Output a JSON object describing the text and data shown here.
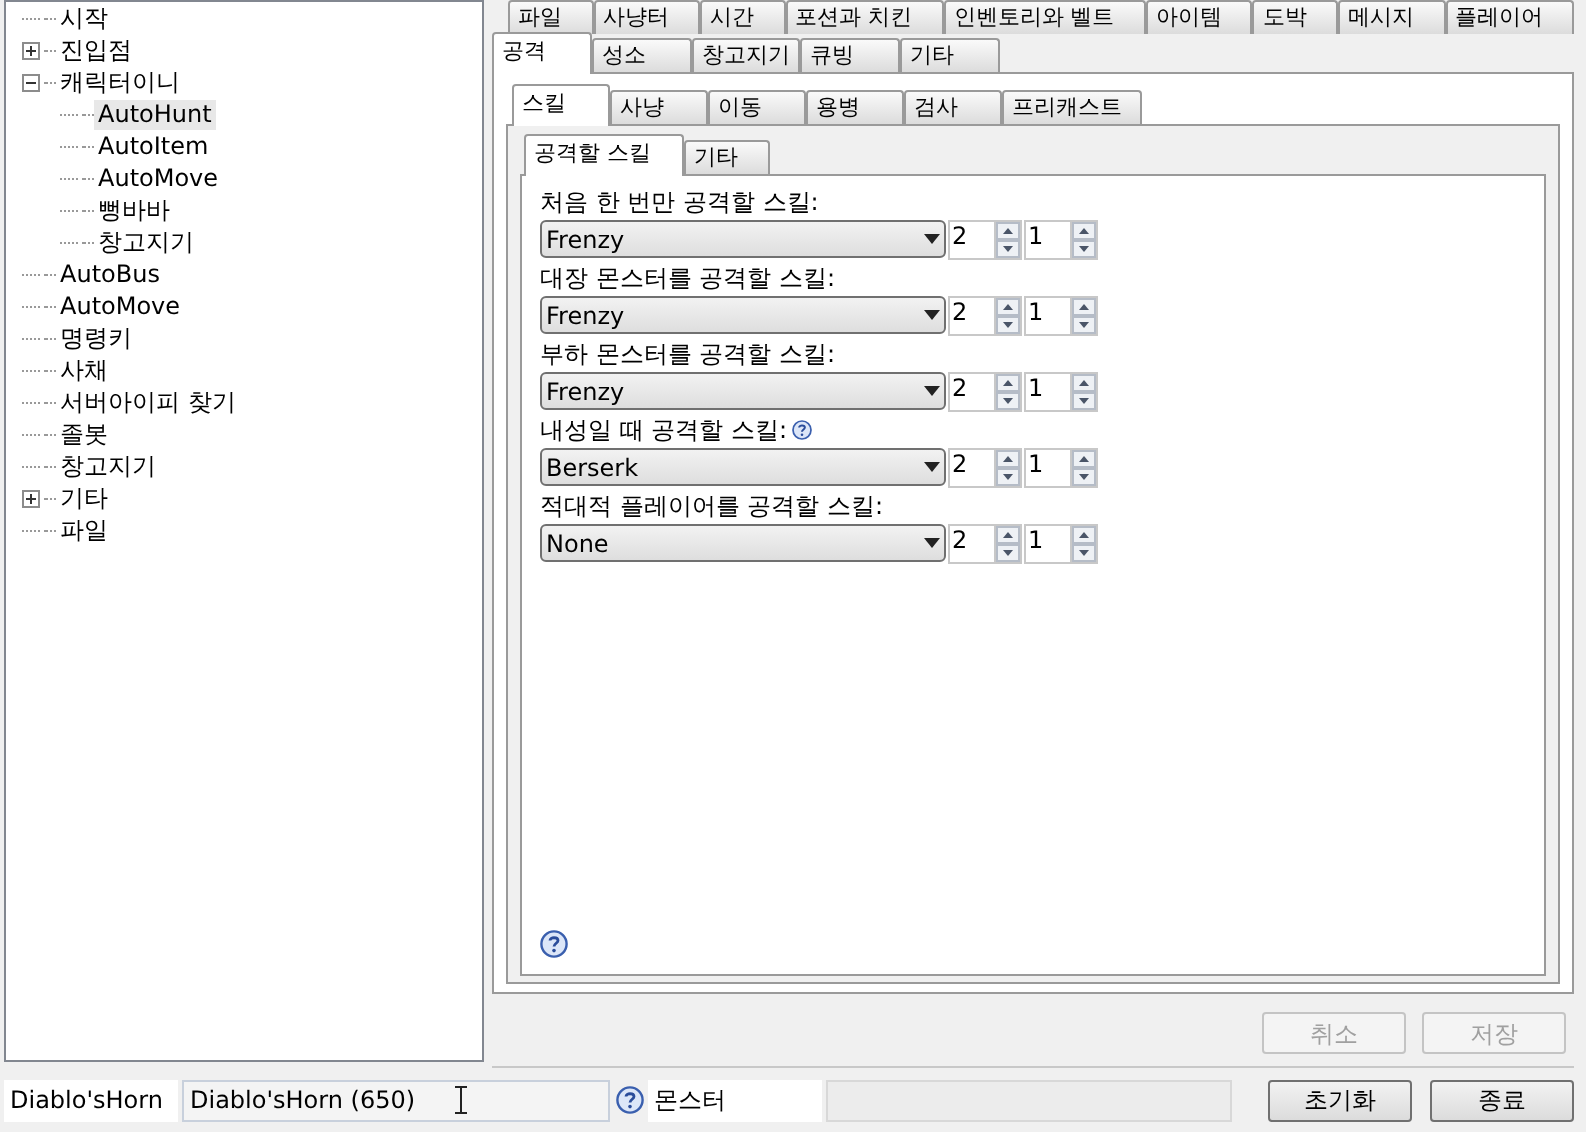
{
  "tree": [
    {
      "label": "시작",
      "selected": false
    },
    {
      "label": "진입점",
      "selected": false,
      "expanded": false
    },
    {
      "label": "캐릭터이니",
      "selected": false,
      "expanded": true,
      "children": [
        {
          "label": "AutoHunt",
          "selected": true
        },
        {
          "label": "AutoItem",
          "selected": false
        },
        {
          "label": "AutoMove",
          "selected": false
        },
        {
          "label": "뻥바바",
          "selected": false
        },
        {
          "label": "창고지기",
          "selected": false
        }
      ]
    },
    {
      "label": "AutoBus",
      "selected": false
    },
    {
      "label": "AutoMove",
      "selected": false
    },
    {
      "label": "명령키",
      "selected": false
    },
    {
      "label": "사채",
      "selected": false
    },
    {
      "label": "서버아이피 찾기",
      "selected": false
    },
    {
      "label": "졸봇",
      "selected": false
    },
    {
      "label": "창고지기",
      "selected": false
    },
    {
      "label": "기타",
      "selected": false,
      "expanded": false
    },
    {
      "label": "파일",
      "selected": false
    }
  ],
  "main_tabs": {
    "back_row": [
      {
        "label": "파일",
        "selected": false
      },
      {
        "label": "사냥터",
        "selected": false
      },
      {
        "label": "시간",
        "selected": false
      },
      {
        "label": "포션과 치킨",
        "selected": false
      },
      {
        "label": "인벤토리와 벨트",
        "selected": false
      },
      {
        "label": "아이템",
        "selected": false
      },
      {
        "label": "도박",
        "selected": false
      },
      {
        "label": "메시지",
        "selected": false
      },
      {
        "label": "플레이어",
        "selected": false
      }
    ],
    "front_row": [
      {
        "label": "공격",
        "selected": true
      },
      {
        "label": "성소",
        "selected": false
      },
      {
        "label": "창고지기",
        "selected": false
      },
      {
        "label": "큐빙",
        "selected": false
      },
      {
        "label": "기타",
        "selected": false
      }
    ]
  },
  "sub_tabs": [
    {
      "label": "스킬",
      "selected": true
    },
    {
      "label": "사냥",
      "selected": false
    },
    {
      "label": "이동",
      "selected": false
    },
    {
      "label": "용병",
      "selected": false
    },
    {
      "label": "검사",
      "selected": false
    },
    {
      "label": "프리캐스트",
      "selected": false
    }
  ],
  "inner_tabs": [
    {
      "label": "공격할 스킬",
      "selected": true
    },
    {
      "label": "기타",
      "selected": false
    }
  ],
  "skills": [
    {
      "label": "처음 한 번만 공격할 스킬:",
      "help": false,
      "value": "Frenzy",
      "spin_1": "2",
      "spin_2": "1"
    },
    {
      "label": "대장 몬스터를 공격할 스킬:",
      "help": false,
      "value": "Frenzy",
      "spin_1": "2",
      "spin_2": "1"
    },
    {
      "label": "부하 몬스터를 공격할 스킬:",
      "help": false,
      "value": "Frenzy",
      "spin_1": "2",
      "spin_2": "1"
    },
    {
      "label": "내성일 때 공격할 스킬:",
      "help": true,
      "value": "Berserk",
      "spin_1": "2",
      "spin_2": "1"
    },
    {
      "label": "적대적 플레이어를 공격할 스킬:",
      "help": false,
      "value": "None",
      "spin_1": "2",
      "spin_2": "1"
    }
  ],
  "panel_buttons": [
    {
      "label": "취소",
      "disabled": true
    },
    {
      "label": "저장",
      "disabled": true
    }
  ],
  "status_bar": {
    "character": "Diablo'sHorn",
    "profile": "Diablo'sHorn (650)",
    "target": "몬스터"
  },
  "footer_buttons": [
    {
      "label": "초기화",
      "disabled": false
    },
    {
      "label": "종료",
      "disabled": false
    }
  ]
}
